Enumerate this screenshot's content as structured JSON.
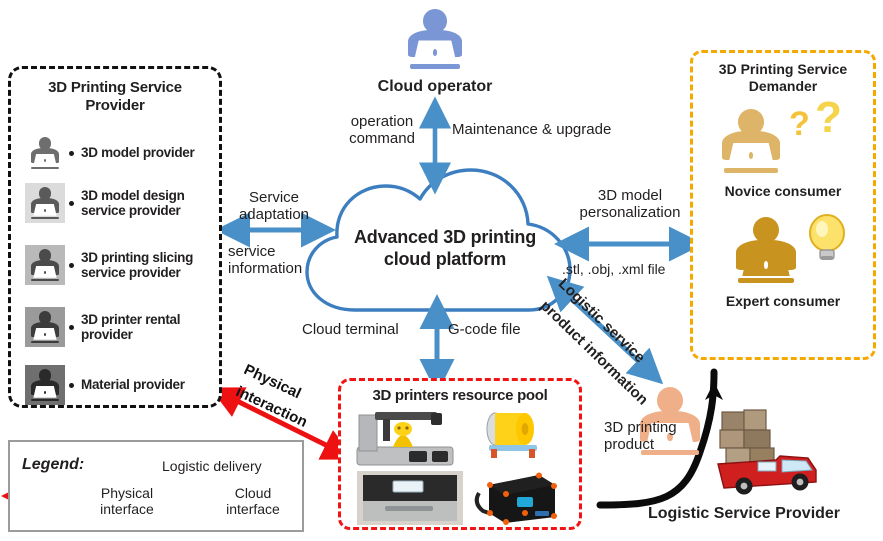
{
  "colors": {
    "cloud_blue": "#3C7EBF",
    "arrow_blue": "#4A90C8",
    "red": "#EE1111",
    "gold": "#F5A800",
    "navy": "#1F3864",
    "operator_blue": "#7B96D4",
    "consumer_light": "#DDB468",
    "consumer_dark": "#C8931E",
    "logistic_skin": "#EFB089",
    "black": "#111111"
  },
  "provider": {
    "title": "3D Printing Service\nProvider",
    "title_line1": "3D Printing Service",
    "title_line2": "Provider",
    "items": [
      {
        "label": "3D model provider",
        "icon": "person-laptop-icon",
        "shade": "#ffffff",
        "fg": "#6E6E6E"
      },
      {
        "label": "3D model design\nservice provider",
        "icon": "person-laptop-icon",
        "shade": "#DBDBDB",
        "fg": "#5A5A5A"
      },
      {
        "label": "3D printing slicing\nservice provider",
        "icon": "person-laptop-icon",
        "shade": "#B9B9B9",
        "fg": "#4B4B4B"
      },
      {
        "label": "3D printer rental\nprovider",
        "icon": "person-laptop-icon",
        "shade": "#9A9A9A",
        "fg": "#3C3C3C"
      },
      {
        "label": "Material provider",
        "icon": "person-laptop-icon",
        "shade": "#6F6F6F",
        "fg": "#2A2A2A"
      }
    ]
  },
  "operator": {
    "label": "Cloud operator",
    "icon": "person-laptop-icon"
  },
  "cloud": {
    "line1": "Advanced 3D printing",
    "line2": "cloud platform"
  },
  "demander": {
    "title_line1": "3D Printing Service",
    "title_line2": "Demander",
    "novice_label": "Novice consumer",
    "expert_label": "Expert consumer",
    "novice_icon": "person-laptop-question-icon",
    "expert_icon": "person-laptop-lightbulb-icon"
  },
  "printers": {
    "title": "3D printers resource pool",
    "images": [
      "desktop-3d-printer-photo",
      "filament-spool-photo",
      "enclosed-3d-printer-photo",
      "dark-3d-printer-photo"
    ]
  },
  "logistic": {
    "label": "Logistic Service Provider",
    "product_line1": "3D printing",
    "product_line2": "product",
    "icon": "person-laptop-icon",
    "truck_icon": "delivery-truck-icon"
  },
  "edges": {
    "operation_command_l1": "operation",
    "operation_command_l2": "command",
    "maintenance": "Maintenance & upgrade",
    "service_adaptation_l1": "Service",
    "service_adaptation_l2": "adaptation",
    "service_information_l1": "service",
    "service_information_l2": "information",
    "model_personalization_l1": "3D model",
    "model_personalization_l2": "personalization",
    "file_types": ".stl, .obj, .xml file",
    "cloud_terminal": "Cloud terminal",
    "gcode_file": "G-code file",
    "logistic_service": "Logistic service",
    "product_information": "product information",
    "physical_interaction_l1": "Physical",
    "physical_interaction_l2": "interaction"
  },
  "legend": {
    "title": "Legend:",
    "logistic_delivery": "Logistic delivery",
    "physical_interface_l1": "Physical",
    "physical_interface_l2": "interface",
    "cloud_interface_l1": "Cloud",
    "cloud_interface_l2": "interface"
  }
}
